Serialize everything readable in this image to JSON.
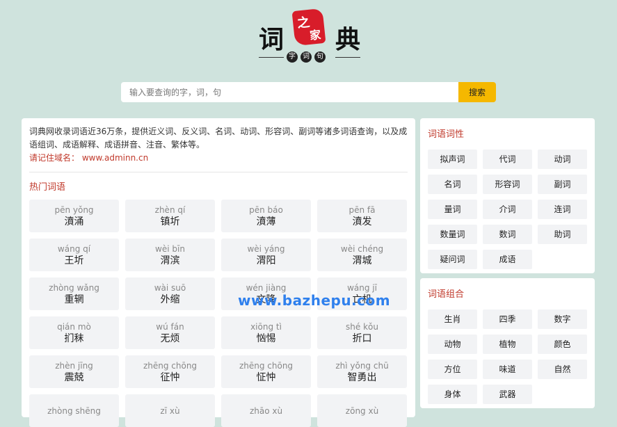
{
  "logo": {
    "char1": "词",
    "char2": "典",
    "seal1": "之",
    "seal2": "家",
    "sub": [
      "字",
      "词",
      "句"
    ]
  },
  "search": {
    "placeholder": "输入要查询的字，词，句",
    "value": "",
    "button": "搜索"
  },
  "main": {
    "intro": "词典网收录词语近36万条，提供近义词、反义词、名词、动词、形容词、副词等诸多词语查询，以及成语组词、成语解释、成语拼音、注音、繁体等。",
    "domain": "请记住域名： www.adminn.cn",
    "hot_title": "热门词语",
    "hot_words": [
      {
        "py": "pēn yǒng",
        "cn": "濆涌"
      },
      {
        "py": "zhèn qí",
        "cn": "镇圻"
      },
      {
        "py": "pēn báo",
        "cn": "濆薄"
      },
      {
        "py": "pēn fā",
        "cn": "濆发"
      },
      {
        "py": "wáng qí",
        "cn": "王圻"
      },
      {
        "py": "wèi bīn",
        "cn": "渭滨"
      },
      {
        "py": "wèi yáng",
        "cn": "渭阳"
      },
      {
        "py": "wèi chéng",
        "cn": "渭城"
      },
      {
        "py": "zhòng wǎng",
        "cn": "重辋"
      },
      {
        "py": "wài suō",
        "cn": "外缩"
      },
      {
        "py": "wén jiàng",
        "cn": "文降"
      },
      {
        "py": "wáng jī",
        "cn": "亡机"
      },
      {
        "py": "qián mò",
        "cn": "扪秣"
      },
      {
        "py": "wú fán",
        "cn": "无烦"
      },
      {
        "py": "xiōng tì",
        "cn": "忷惕"
      },
      {
        "py": "shé kǒu",
        "cn": "折口"
      },
      {
        "py": "zhèn jīng",
        "cn": "震兢"
      },
      {
        "py": "zhēng chōng",
        "cn": "征忡"
      },
      {
        "py": "zhēng chōng",
        "cn": "怔忡"
      },
      {
        "py": "zhì yǒng chū",
        "cn": "智勇出"
      },
      {
        "py": "zhòng shēng",
        "cn": ""
      },
      {
        "py": "zī xù",
        "cn": ""
      },
      {
        "py": "zhāo xù",
        "cn": ""
      },
      {
        "py": "zōng xù",
        "cn": ""
      }
    ]
  },
  "cixing": {
    "title": "词语词性",
    "items": [
      "拟声词",
      "代词",
      "动词",
      "名词",
      "形容词",
      "副词",
      "量词",
      "介词",
      "连词",
      "数量词",
      "数词",
      "助词",
      "疑问词",
      "成语"
    ]
  },
  "zuhe": {
    "title": "词语组合",
    "items": [
      "生肖",
      "四季",
      "数字",
      "动物",
      "植物",
      "颜色",
      "方位",
      "味道",
      "自然",
      "身体",
      "武器"
    ]
  },
  "watermark": "www.bazhepu.com"
}
